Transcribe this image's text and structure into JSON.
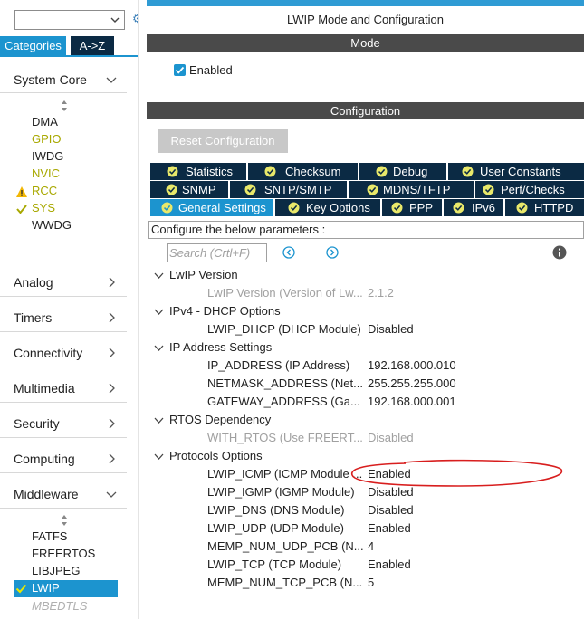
{
  "left": {
    "tabs": {
      "categories": "Categories",
      "az": "A->Z"
    },
    "sections": [
      {
        "label": "System Core",
        "expanded": true
      },
      {
        "label": "Analog",
        "expanded": false
      },
      {
        "label": "Timers",
        "expanded": false
      },
      {
        "label": "Connectivity",
        "expanded": false
      },
      {
        "label": "Multimedia",
        "expanded": false
      },
      {
        "label": "Security",
        "expanded": false
      },
      {
        "label": "Computing",
        "expanded": false
      },
      {
        "label": "Middleware",
        "expanded": true
      }
    ],
    "system_core_items": [
      {
        "label": "DMA",
        "state": "normal"
      },
      {
        "label": "GPIO",
        "state": "configured"
      },
      {
        "label": "IWDG",
        "state": "normal"
      },
      {
        "label": "NVIC",
        "state": "configured"
      },
      {
        "label": "RCC",
        "state": "warning"
      },
      {
        "label": "SYS",
        "state": "checked"
      },
      {
        "label": "WWDG",
        "state": "normal"
      }
    ],
    "middleware_items": [
      {
        "label": "FATFS",
        "state": "normal"
      },
      {
        "label": "FREERTOS",
        "state": "normal"
      },
      {
        "label": "LIBJPEG",
        "state": "normal"
      },
      {
        "label": "LWIP",
        "state": "selected"
      },
      {
        "label": "MBEDTLS",
        "state": "disabled"
      }
    ]
  },
  "right": {
    "title": "LWIP Mode and Configuration",
    "mode_bar": "Mode",
    "enabled_label": "Enabled",
    "config_bar": "Configuration",
    "reset_button": "Reset Configuration",
    "tabs_row1": [
      "Statistics",
      "Checksum",
      "Debug",
      "User Constants"
    ],
    "tabs_row2": [
      "SNMP",
      "SNTP/SMTP",
      "MDNS/TFTP",
      "Perf/Checks"
    ],
    "tabs_row3": [
      "General Settings",
      "Key Options",
      "PPP",
      "IPv6",
      "HTTPD"
    ],
    "active_tab": "General Settings",
    "param_label": "Configure the below parameters :",
    "search_placeholder": "Search (Crtl+F)",
    "groups": [
      {
        "label": "LwIP Version",
        "params": [
          {
            "name": "LwIP Version (Version of Lw...",
            "value": "2.1.2",
            "dim": true
          }
        ]
      },
      {
        "label": "IPv4 - DHCP Options",
        "params": [
          {
            "name": "LWIP_DHCP (DHCP Module)",
            "value": "Disabled",
            "dim": false
          }
        ]
      },
      {
        "label": "IP Address Settings",
        "params": [
          {
            "name": "IP_ADDRESS (IP Address)",
            "value": "192.168.000.010",
            "dim": false
          },
          {
            "name": "NETMASK_ADDRESS (Net...",
            "value": "255.255.255.000",
            "dim": false
          },
          {
            "name": "GATEWAY_ADDRESS (Ga...",
            "value": "192.168.000.001",
            "dim": false
          }
        ]
      },
      {
        "label": "RTOS Dependency",
        "params": [
          {
            "name": "WITH_RTOS (Use FREERT...",
            "value": "Disabled",
            "dim": true
          }
        ]
      },
      {
        "label": "Protocols Options",
        "params": [
          {
            "name": "LWIP_ICMP (ICMP Module ...",
            "value": "Enabled",
            "dim": false
          },
          {
            "name": "LWIP_IGMP (IGMP Module)",
            "value": "Disabled",
            "dim": false
          },
          {
            "name": "LWIP_DNS (DNS Module)",
            "value": "Disabled",
            "dim": false
          },
          {
            "name": "LWIP_UDP (UDP Module)",
            "value": "Enabled",
            "dim": false
          },
          {
            "name": "MEMP_NUM_UDP_PCB (N...",
            "value": "4",
            "dim": false
          },
          {
            "name": "LWIP_TCP (TCP Module)",
            "value": "Enabled",
            "dim": false
          },
          {
            "name": "MEMP_NUM_TCP_PCB (N...",
            "value": "5",
            "dim": false
          }
        ]
      }
    ]
  },
  "colors": {
    "accent": "#1c94cf",
    "dark_tab": "#0b2a44",
    "configured_text": "#a8a800",
    "warning": "#f2b705",
    "check": "#a8a800",
    "annotation": "#d81e1e"
  }
}
